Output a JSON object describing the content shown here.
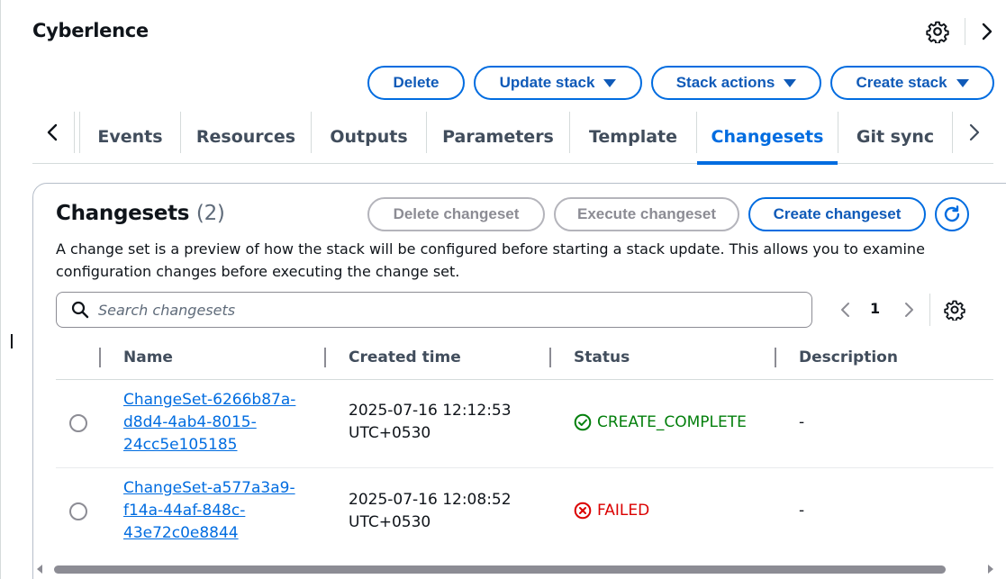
{
  "header": {
    "title": "Cyberlence"
  },
  "actions": {
    "delete": "Delete",
    "update_stack": "Update stack",
    "stack_actions": "Stack actions",
    "create_stack": "Create stack"
  },
  "tabs": [
    {
      "label": "Events",
      "active": false
    },
    {
      "label": "Resources",
      "active": false
    },
    {
      "label": "Outputs",
      "active": false
    },
    {
      "label": "Parameters",
      "active": false
    },
    {
      "label": "Template",
      "active": false
    },
    {
      "label": "Changesets",
      "active": true
    },
    {
      "label": "Git sync",
      "active": false
    }
  ],
  "panel": {
    "title": "Changesets",
    "count": "(2)",
    "delete_button": "Delete changeset",
    "execute_button": "Execute changeset",
    "create_button": "Create changeset",
    "description": "A change set is a preview of how the stack will be configured before starting a stack update. This allows you to examine configuration changes before executing the change set."
  },
  "search": {
    "placeholder": "Search changesets",
    "value": ""
  },
  "pagination": {
    "current_page": "1"
  },
  "table": {
    "columns": [
      "Name",
      "Created time",
      "Status",
      "Description"
    ],
    "rows": [
      {
        "name_lines": [
          "ChangeSet-6266b87a-",
          "d8d4-4ab4-8015-",
          "24cc5e105185"
        ],
        "created_lines": [
          "2025-07-16 12:12:53",
          "UTC+0530"
        ],
        "status": "CREATE_COMPLETE",
        "description": "-"
      },
      {
        "name_lines": [
          "ChangeSet-a577a3a9-",
          "f14a-44af-848c-",
          "43e72c0e8844"
        ],
        "created_lines": [
          "2025-07-16 12:08:52",
          "UTC+0530"
        ],
        "status": "FAILED",
        "description": "-"
      }
    ]
  },
  "colors": {
    "accent": "#006ce0",
    "success": "#037f0c",
    "error": "#db0000",
    "disabled": "#b4b4bb"
  },
  "icons": [
    "settings-gear-icon",
    "chevron-right-icon",
    "chevron-left-icon",
    "caret-down-icon",
    "refresh-icon",
    "search-icon",
    "success-check-icon",
    "error-x-icon"
  ]
}
